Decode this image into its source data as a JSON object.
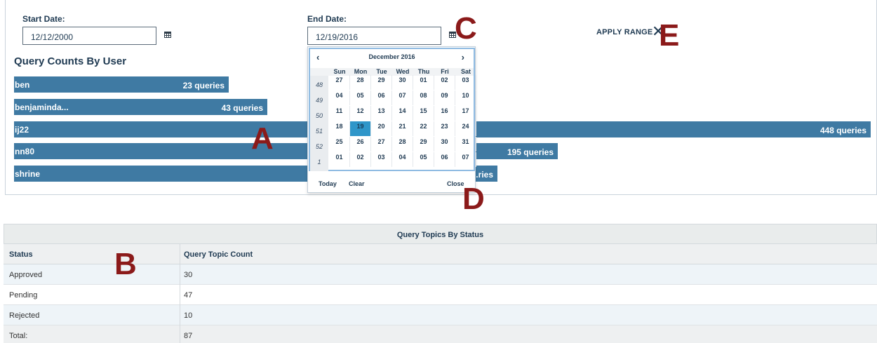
{
  "filters": {
    "start_label": "Start Date:",
    "start_value": "12/12/2000",
    "end_label": "End Date:",
    "end_value": "12/19/2016",
    "apply_label": "APPLY RANGE",
    "apply_icon": "x-icon"
  },
  "markers": {
    "a": "A",
    "b": "B",
    "c": "C",
    "d": "D",
    "e": "E"
  },
  "query_counts": {
    "title": "Query Counts By User",
    "users": [
      {
        "name": "ben",
        "label": "23 queries",
        "count": 23
      },
      {
        "name": "benjaminda...",
        "label": "43 queries",
        "count": 43
      },
      {
        "name": "ij22",
        "label": "448 queries",
        "count": 448
      },
      {
        "name": "nn80",
        "label": "195 queries",
        "count": 195
      },
      {
        "name": "shrine",
        "label": "...ries",
        "count": null
      }
    ]
  },
  "datepicker": {
    "prev": "‹",
    "next": "›",
    "month": "December 2016",
    "days_of_week": [
      "Sun",
      "Mon",
      "Tue",
      "Wed",
      "Thu",
      "Fri",
      "Sat"
    ],
    "weeks": [
      {
        "num": "48",
        "days": [
          "27",
          "28",
          "29",
          "30",
          "01",
          "02",
          "03"
        ]
      },
      {
        "num": "49",
        "days": [
          "04",
          "05",
          "06",
          "07",
          "08",
          "09",
          "10"
        ]
      },
      {
        "num": "50",
        "days": [
          "11",
          "12",
          "13",
          "14",
          "15",
          "16",
          "17"
        ]
      },
      {
        "num": "51",
        "days": [
          "18",
          "19",
          "20",
          "21",
          "22",
          "23",
          "24"
        ]
      },
      {
        "num": "52",
        "days": [
          "25",
          "26",
          "27",
          "28",
          "29",
          "30",
          "31"
        ]
      },
      {
        "num": "1",
        "days": [
          "01",
          "02",
          "03",
          "04",
          "05",
          "06",
          "07"
        ]
      }
    ],
    "selected": "19",
    "today_label": "Today",
    "clear_label": "Clear",
    "close_label": "Close"
  },
  "topics_table": {
    "caption": "Query Topics By Status",
    "headers": [
      "Status",
      "Query Topic Count"
    ],
    "rows": [
      {
        "status": "Approved",
        "count": "30"
      },
      {
        "status": "Pending",
        "count": "47"
      },
      {
        "status": "Rejected",
        "count": "10"
      },
      {
        "status": "Total:",
        "count": "87"
      }
    ]
  },
  "colors": {
    "bar": "#3f7aa3",
    "marker": "#8b1a1a",
    "selected_day": "#2f96c9",
    "text": "#1f3a52"
  }
}
